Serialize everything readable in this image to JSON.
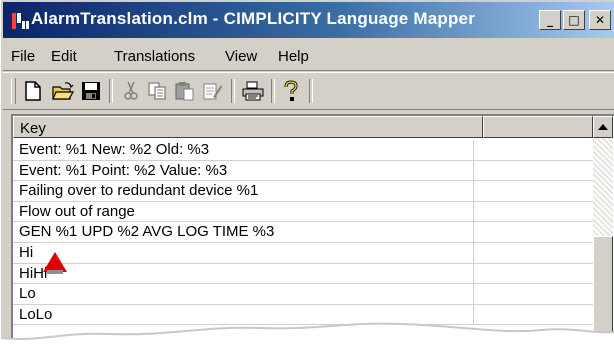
{
  "window": {
    "title": "AlarmTranslation.clm - CIMPLICITY Language Mapper",
    "app_icon": "language-mapper-icon",
    "controls": {
      "minimize": "_",
      "maximize": "□",
      "close": "✕"
    }
  },
  "menu": [
    "File",
    "Edit",
    "Translations",
    "View",
    "Help"
  ],
  "toolbar": {
    "icons": [
      "new-document-icon",
      "open-folder-icon",
      "save-icon",
      "cut-icon",
      "copy-icon",
      "paste-icon",
      "properties-icon",
      "print-icon",
      "help-icon"
    ]
  },
  "list": {
    "columns": [
      "Key",
      ""
    ],
    "rows": [
      "Event: %1 New: %2  Old: %3",
      "Event: %1 Point: %2 Value: %3",
      "Failing over to redundant device %1",
      "Flow out of range",
      "GEN %1 UPD %2 AVG LOG TIME %3",
      "Hi",
      "HiHi",
      "Lo",
      "LoLo"
    ]
  },
  "colors": {
    "titlebar_start": "#0a246a",
    "titlebar_end": "#a6caf0",
    "marker": "#e00000"
  }
}
